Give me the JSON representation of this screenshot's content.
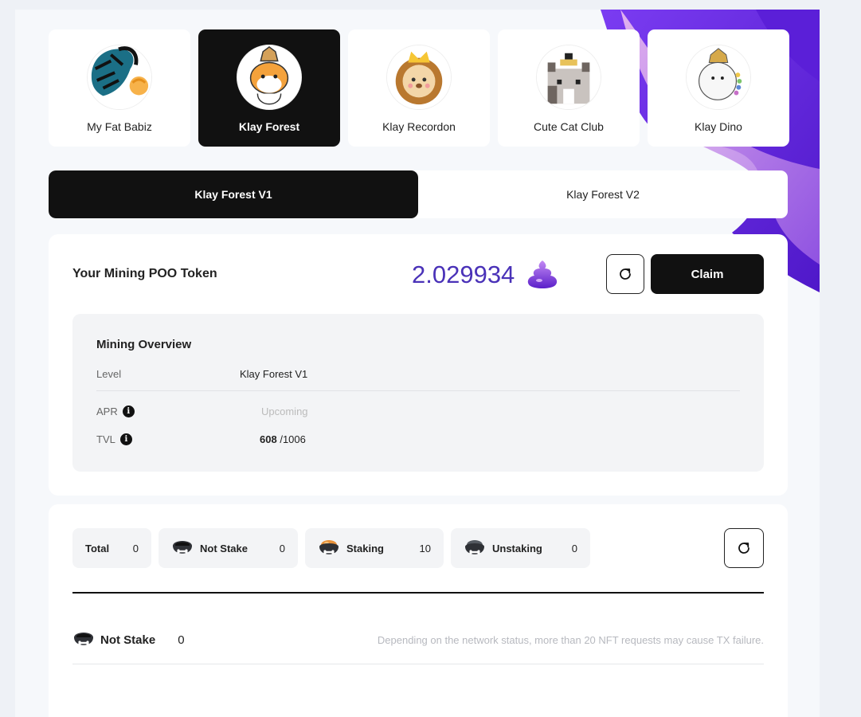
{
  "collections": [
    {
      "name": "My Fat Babiz",
      "icon": "fat-babiz-avatar-icon",
      "active": false
    },
    {
      "name": "Klay Forest",
      "icon": "klay-forest-avatar-icon",
      "active": true
    },
    {
      "name": "Klay Recordon",
      "icon": "lion-avatar-icon",
      "active": false
    },
    {
      "name": "Cute Cat Club",
      "icon": "cat-avatar-icon",
      "active": false
    },
    {
      "name": "Klay Dino",
      "icon": "dino-avatar-icon",
      "active": false
    }
  ],
  "tabs": [
    {
      "label": "Klay Forest V1",
      "active": true
    },
    {
      "label": "Klay Forest V2",
      "active": false
    }
  ],
  "mining": {
    "title": "Your Mining POO Token",
    "amount": "2.029934",
    "claim_label": "Claim",
    "overview": {
      "title": "Mining Overview",
      "level_label": "Level",
      "level_value": "Klay Forest V1",
      "apr_label": "APR",
      "apr_value": "Upcoming",
      "tvl_label": "TVL",
      "tvl_current": "608",
      "tvl_total": "/1006"
    }
  },
  "nft_stats": {
    "total": {
      "label": "Total",
      "value": "0"
    },
    "not_stake": {
      "label": "Not Stake",
      "value": "0"
    },
    "staking": {
      "label": "Staking",
      "value": "10"
    },
    "unstaking": {
      "label": "Unstaking",
      "value": "0"
    }
  },
  "not_stake_section": {
    "label": "Not Stake",
    "count": "0",
    "note": "Depending on the network status, more than 20 NFT requests may cause TX failure."
  },
  "colors": {
    "accent": "#4a32b8",
    "dark": "#111111",
    "blob": "#6d2ee0"
  }
}
